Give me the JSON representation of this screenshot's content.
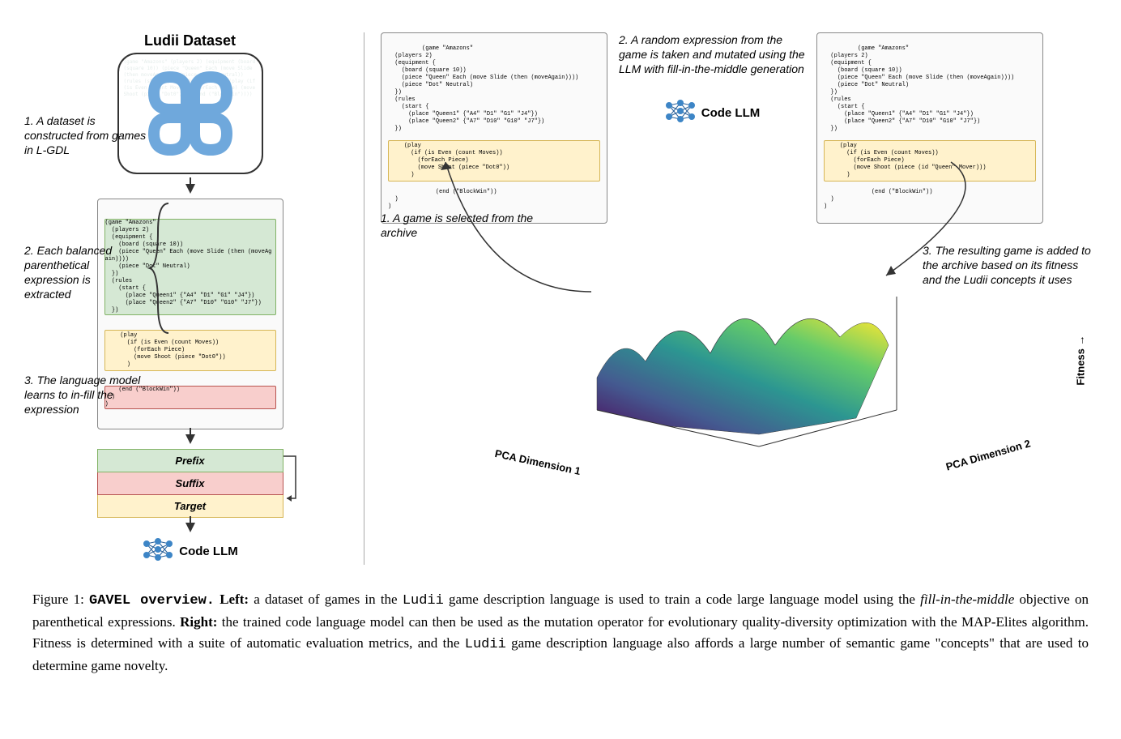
{
  "left": {
    "datasetTitle": "Ludii Dataset",
    "step1": "1. A dataset is constructed from games in L-GDL",
    "step2": "2. Each balanced parenthetical expression is extracted",
    "step3": "3. The language model learns to in-fill the expression",
    "prefixLabel": "Prefix",
    "suffixLabel": "Suffix",
    "targetLabel": "Target",
    "llmLabel": "Code LLM",
    "code": {
      "header": "(game \"Amazons\"\n  (players 2)\n  (equipment {\n    (board (square 10))\n    (piece \"Queen\" Each (move Slide (then (moveAgain))))\n    (piece \"Dot\" Neutral)\n  })\n  (rules\n    (start {\n      (place \"Queen1\" {\"A4\" \"D1\" \"G1\" \"J4\"})\n      (place \"Queen2\" {\"A7\" \"D10\" \"G10\" \"J7\"})\n  })",
      "play": "    (play\n      (if (is Even (count Moves))\n        (forEach Piece)\n        (move Shoot (piece \"Dot0\"))\n      )",
      "footer": "    (end (\"BlockWin\"))\n  )\n)"
    }
  },
  "right": {
    "step1": "1. A game is selected from the archive",
    "step2": "2. A random expression from the game is taken and mutated using the LLM with fill-in-the-middle generation",
    "step3": "3. The resulting game is added to the archive based on its fitness and the Ludii concepts it uses",
    "llmLabel": "Code LLM",
    "axis1": "PCA Dimension 1",
    "axis2": "PCA Dimension 2",
    "axisZ": "Fitness →",
    "codeA": {
      "header": "(game \"Amazons\"\n  (players 2)\n  (equipment {\n    (board (square 10))\n    (piece \"Queen\" Each (move Slide (then (moveAgain))))\n    (piece \"Dot\" Neutral)\n  })\n  (rules\n    (start {\n      (place \"Queen1\" {\"A4\" \"D1\" \"G1\" \"J4\"})\n      (place \"Queen2\" {\"A7\" \"D10\" \"G10\" \"J7\"})\n  })",
      "play": "    (play\n      (if (is Even (count Moves))\n        (forEach Piece)\n        (move Shoot (piece \"Dot0\"))\n      )",
      "footer": "    (end (\"BlockWin\"))\n  )\n)"
    },
    "codeB": {
      "header": "(game \"Amazons\"\n  (players 2)\n  (equipment {\n    (board (square 10))\n    (piece \"Queen\" Each (move Slide (then (moveAgain))))\n    (piece \"Dot\" Neutral)\n  })\n  (rules\n    (start {\n      (place \"Queen1\" {\"A4\" \"D1\" \"G1\" \"J4\"})\n      (place \"Queen2\" {\"A7\" \"D10\" \"G10\" \"J7\"})\n  })",
      "play": "    (play\n      (if (is Even (count Moves))\n        (forEach Piece)\n        (move Shoot (piece (id \"Queen\" Mover)))\n      )",
      "footer": "    (end (\"BlockWin\"))\n  )\n)"
    }
  },
  "caption": {
    "fig": "Figure 1:",
    "title": "GAVEL overview.",
    "leftLabel": "Left:",
    "leftText": " a dataset of games in the ",
    "ludii": "Ludii",
    "leftText2": " game description language is used to train a code large language model using the ",
    "fim": "fill-in-the-middle",
    "leftText3": " objective on parenthetical expressions. ",
    "rightLabel": "Right:",
    "rightText": " the trained code language model can then be used as the mutation operator for evolutionary quality-diversity optimization with the MAP-Elites algorithm. Fitness is determined with a suite of automatic evaluation metrics, and the ",
    "rightText2": " game description language also affords a large number of semantic game \"concepts\" that are used to determine game novelty."
  }
}
